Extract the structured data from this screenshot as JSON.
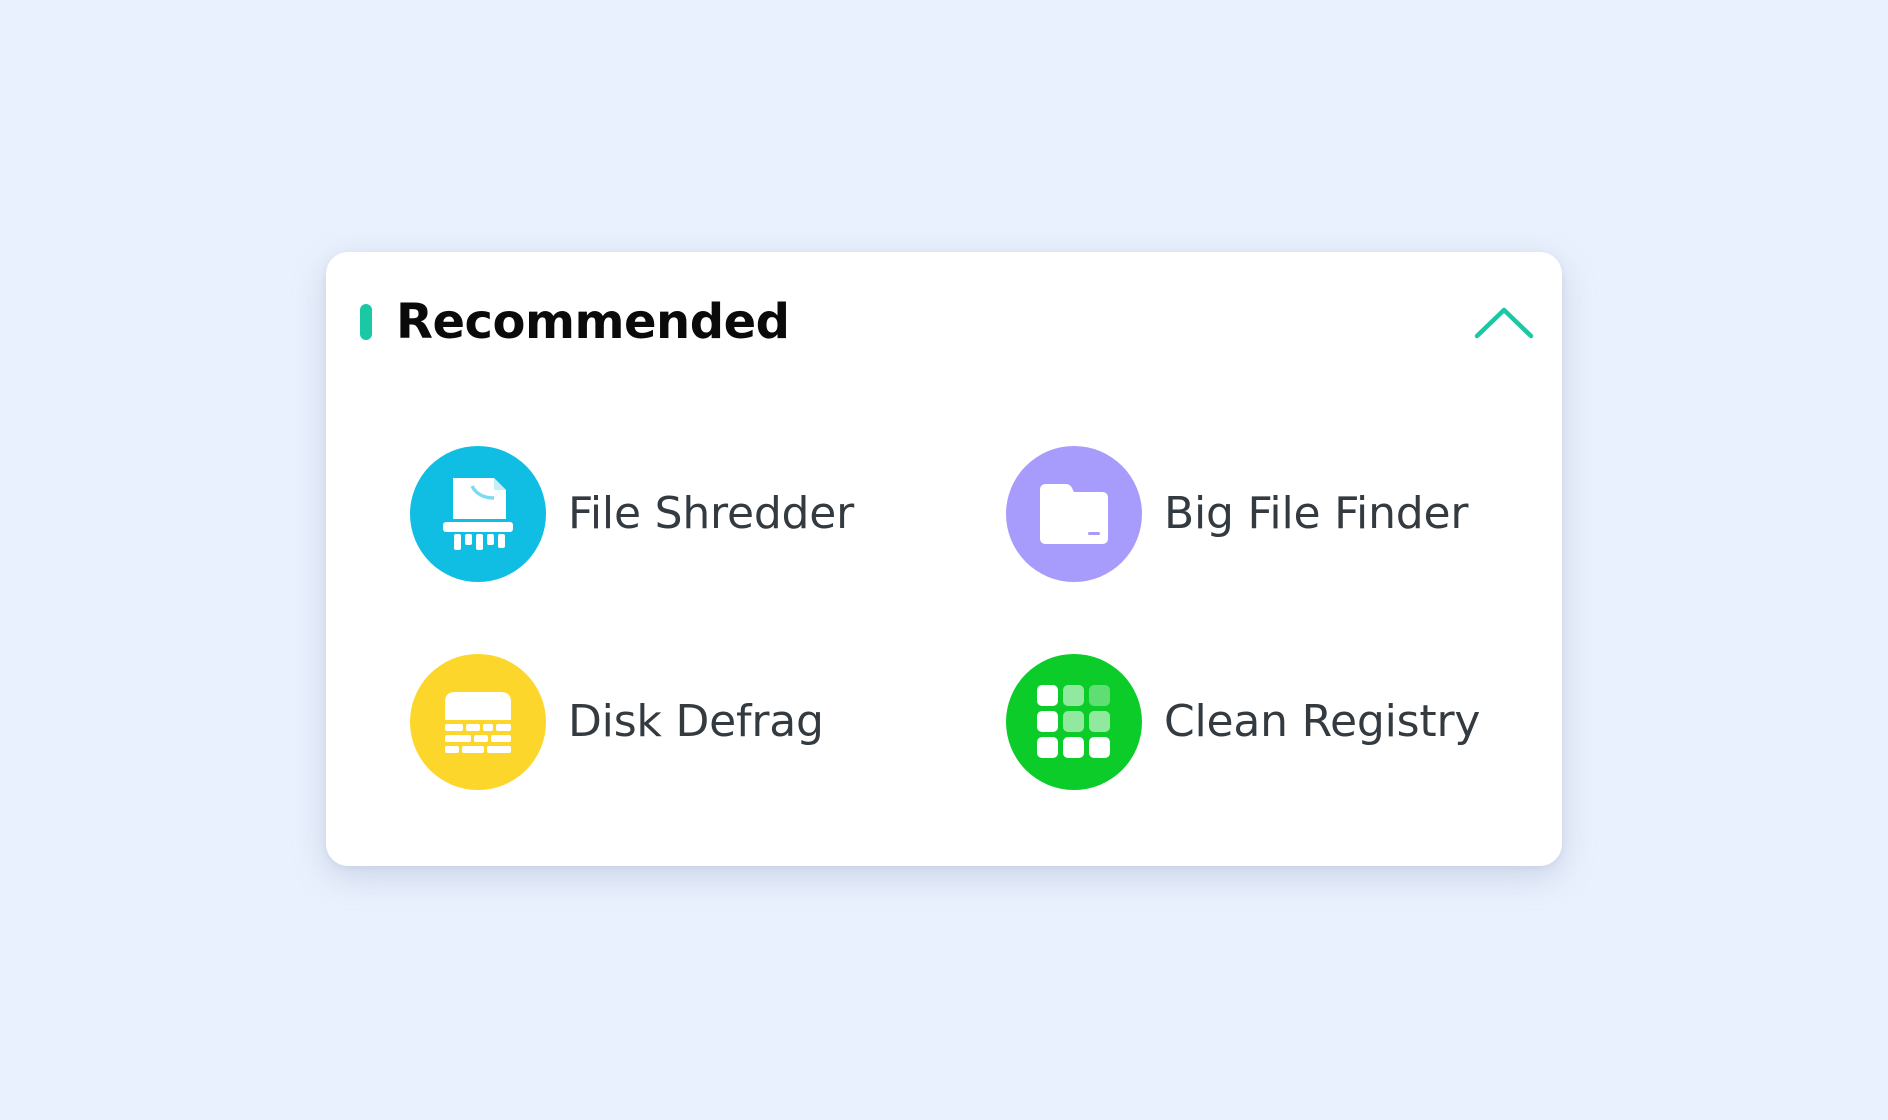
{
  "panel": {
    "title": "Recommended",
    "accent_color": "#19c8a4",
    "collapse_icon": "chevron-up-icon"
  },
  "tools": [
    {
      "label": "File Shredder",
      "icon": "file-shredder-icon",
      "color": "#10bde3"
    },
    {
      "label": "Big File Finder",
      "icon": "folder-icon",
      "color": "#a79cfb"
    },
    {
      "label": "Disk Defrag",
      "icon": "disk-defrag-icon",
      "color": "#fcd62a"
    },
    {
      "label": "Clean Registry",
      "icon": "registry-grid-icon",
      "color": "#0ccc2a"
    }
  ]
}
